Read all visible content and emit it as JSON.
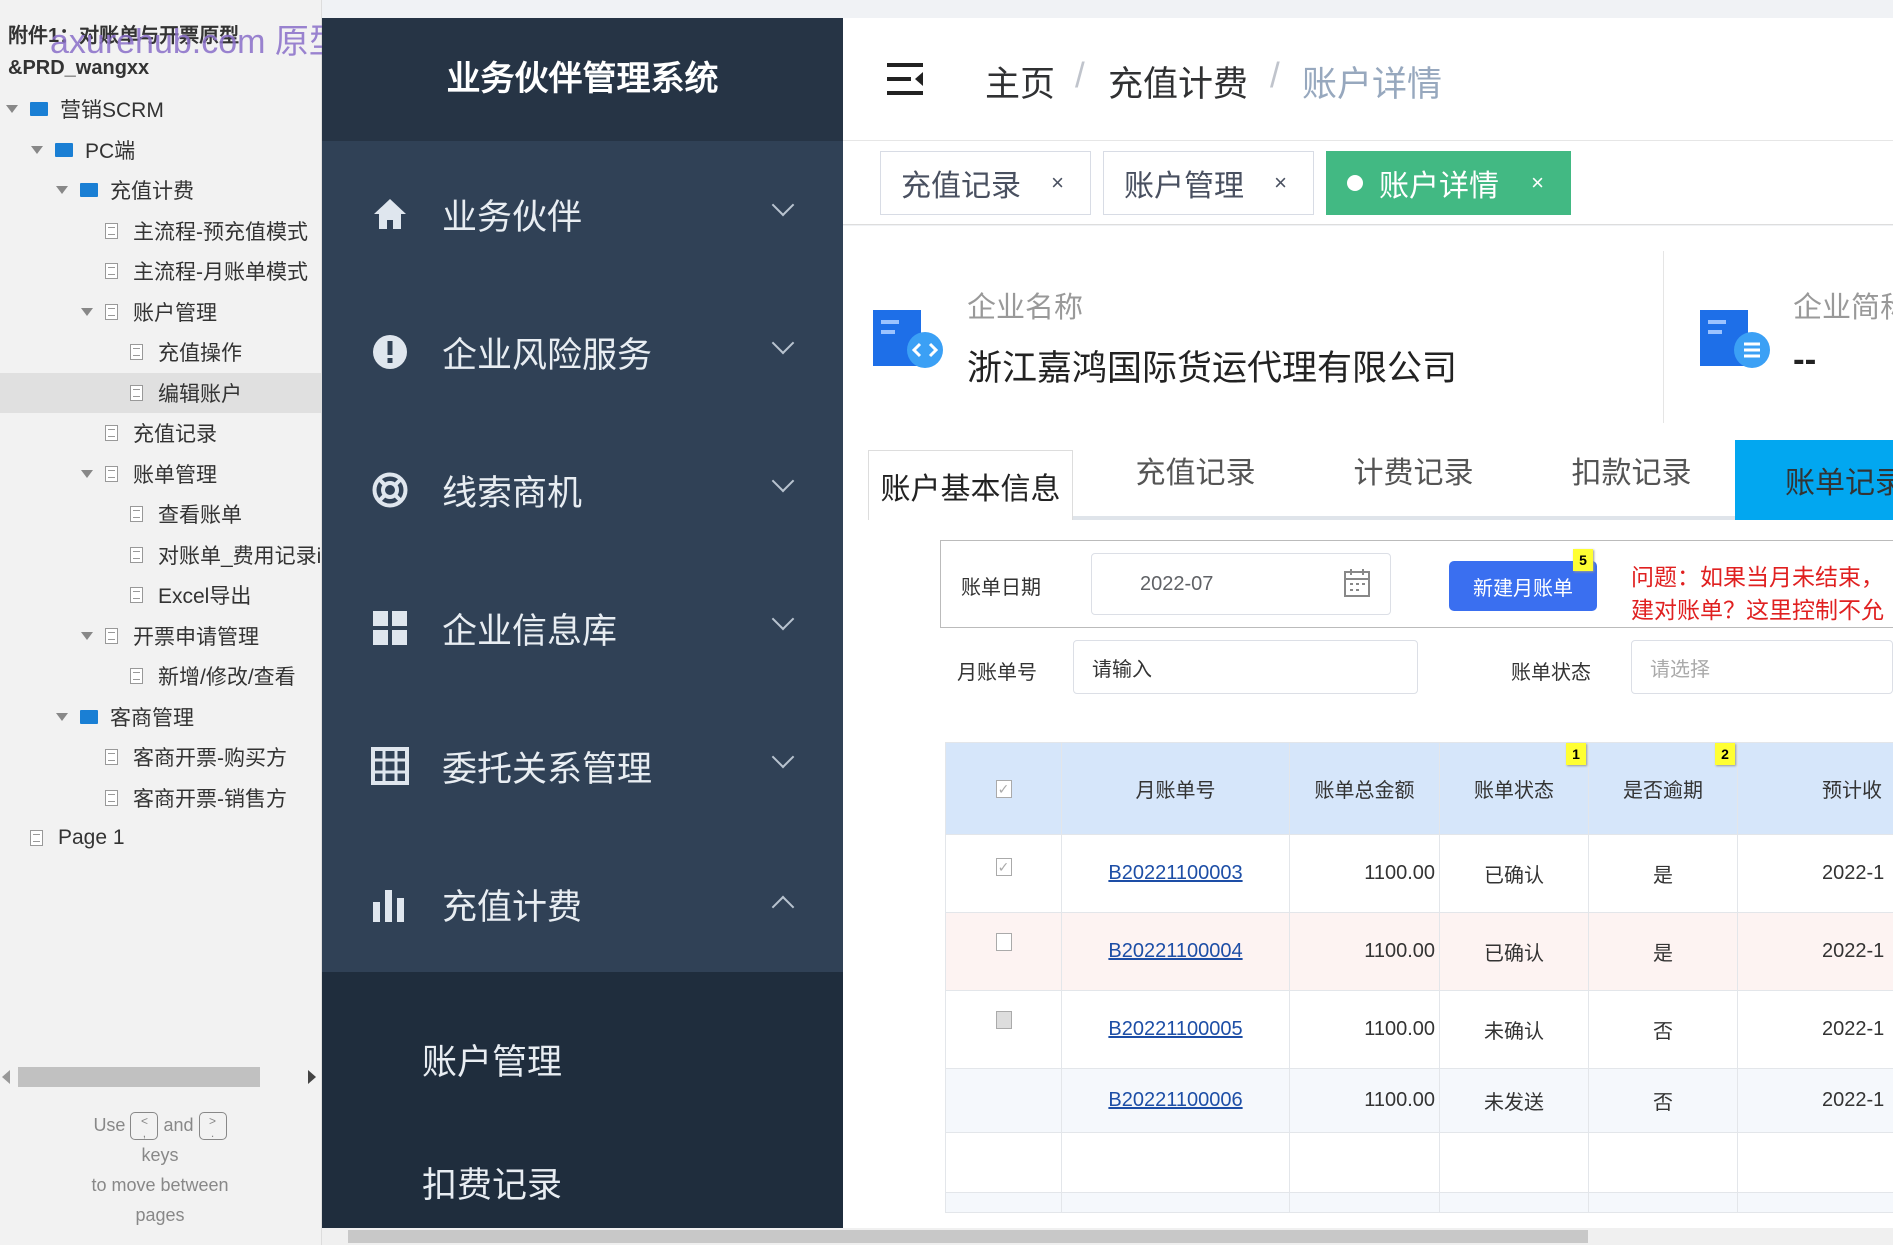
{
  "doc": {
    "title_line1": "附件1：对账单与开票原型",
    "title_line2": "&PRD_wangxx",
    "watermark": "axurehub.com 原型资源站"
  },
  "tree": [
    {
      "level": 0,
      "type": "folder",
      "label": "营销SCRM",
      "expanded": true
    },
    {
      "level": 1,
      "type": "folder",
      "label": "PC端",
      "expanded": true
    },
    {
      "level": 2,
      "type": "folder",
      "label": "充值计费",
      "expanded": true
    },
    {
      "level": 3,
      "type": "page",
      "label": "主流程-预充值模式"
    },
    {
      "level": 3,
      "type": "page",
      "label": "主流程-月账单模式"
    },
    {
      "level": 3,
      "type": "page",
      "label": "账户管理",
      "expanded": true
    },
    {
      "level": 4,
      "type": "page",
      "label": "充值操作"
    },
    {
      "level": 4,
      "type": "page",
      "label": "编辑账户",
      "selected": true
    },
    {
      "level": 3,
      "type": "page",
      "label": "充值记录"
    },
    {
      "level": 3,
      "type": "page",
      "label": "账单管理",
      "expanded": true
    },
    {
      "level": 4,
      "type": "page",
      "label": "查看账单"
    },
    {
      "level": 4,
      "type": "page",
      "label": "对账单_费用记录i"
    },
    {
      "level": 4,
      "type": "page",
      "label": "Excel导出"
    },
    {
      "level": 3,
      "type": "page",
      "label": "开票申请管理",
      "expanded": true
    },
    {
      "level": 4,
      "type": "page",
      "label": "新增/修改/查看"
    },
    {
      "level": 2,
      "type": "folder",
      "label": "客商管理",
      "expanded": true
    },
    {
      "level": 3,
      "type": "page",
      "label": "客商开票-购买方"
    },
    {
      "level": 3,
      "type": "page",
      "label": "客商开票-销售方"
    },
    {
      "level": 0,
      "type": "page",
      "label": "Page 1",
      "noarrow": true
    }
  ],
  "help": {
    "use": "Use",
    "key1_top": "<",
    "key1_bottom": ",",
    "and": "and",
    "key2_top": ">",
    "key2_bottom": ".",
    "keys": "keys",
    "line3": "to move between",
    "line4": "pages"
  },
  "sidebar": {
    "title": "业务伙伴管理系统",
    "items": [
      {
        "label": "业务伙伴",
        "icon": "home-icon"
      },
      {
        "label": "企业风险服务",
        "icon": "alert-icon"
      },
      {
        "label": "线索商机",
        "icon": "lifebuoy-icon"
      },
      {
        "label": "企业信息库",
        "icon": "grid-icon"
      },
      {
        "label": "委托关系管理",
        "icon": "table-icon"
      },
      {
        "label": "充值计费",
        "icon": "bar-chart-icon",
        "expanded": true
      }
    ],
    "subitems": [
      "账户管理",
      "扣费记录"
    ]
  },
  "breadcrumb": [
    "主页",
    "充值计费",
    "账户详情"
  ],
  "breadcrumb_sep": "/",
  "tabs": [
    {
      "label": "充值记录"
    },
    {
      "label": "账户管理"
    },
    {
      "label": "账户详情",
      "active": true
    }
  ],
  "tab_close": "×",
  "company": {
    "name_label": "企业名称",
    "name": "浙江嘉鸿国际货运代理有限公司",
    "short_label": "企业简称",
    "short": "--"
  },
  "inner_tabs": [
    "账户基本信息",
    "充值记录",
    "计费记录",
    "扣款记录",
    "账单记录"
  ],
  "filter": {
    "date_label": "账单日期",
    "date_value": "2022-07",
    "new_button": "新建月账单",
    "new_badge": "5",
    "note_line1": "问题：如果当月未结束，",
    "note_line2": "建对账单？这里控制不允",
    "no_label": "月账单号",
    "no_placeholder": "请输入",
    "status_label": "账单状态",
    "status_placeholder": "请选择"
  },
  "table": {
    "headers": [
      "月账单号",
      "账单总金额",
      "账单状态",
      "是否逾期",
      "预计收"
    ],
    "badges": {
      "status": "1",
      "overdue": "2"
    },
    "rows": [
      {
        "checkbox": "checked",
        "no": "B20221100003",
        "amount": "1100.00",
        "status": "已确认",
        "overdue": "是",
        "date": "2022-1"
      },
      {
        "checkbox": "unchecked",
        "no": "B20221100004",
        "amount": "1100.00",
        "status": "已确认",
        "overdue": "是",
        "date": "2022-1",
        "highlight": true
      },
      {
        "checkbox": "disabled",
        "no": "B20221100005",
        "amount": "1100.00",
        "status": "未确认",
        "overdue": "否",
        "date": "2022-1"
      },
      {
        "checkbox": "none",
        "no": "B20221100006",
        "amount": "1100.00",
        "status": "未发送",
        "overdue": "否",
        "date": "2022-1"
      }
    ]
  },
  "colors": {
    "sidebar": "#304156",
    "active_tab": "#42b983",
    "inner_tab_active": "#02a7f0",
    "button": "#3a6ff0",
    "note": "#e02020",
    "table_header": "#d6e6fa",
    "row_highlight": "#fdf3f2"
  }
}
